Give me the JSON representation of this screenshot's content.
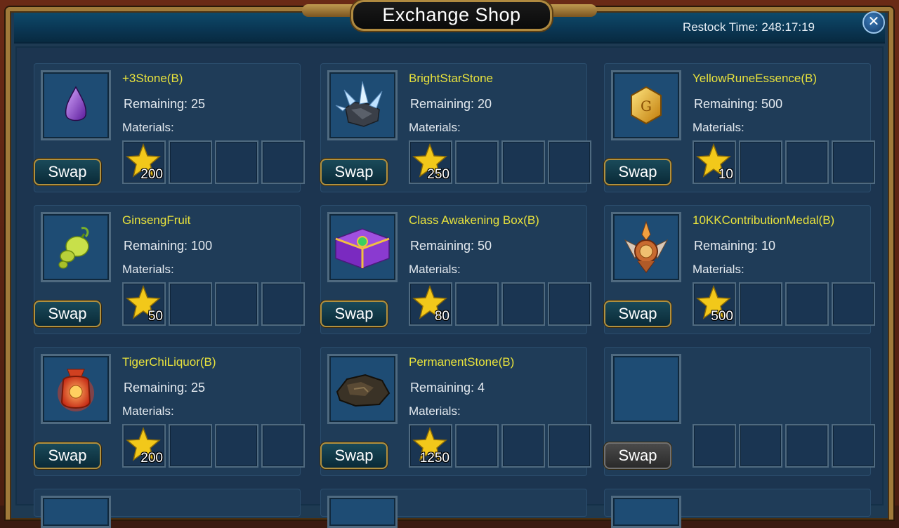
{
  "window": {
    "title": "Exchange Shop",
    "restock": "Restock Time: 248:17:19",
    "close_icon": "close-icon"
  },
  "items": [
    {
      "name": "+3Stone(B)",
      "remaining": "Remaining: 25",
      "materials_label": "Materials:",
      "material_qty": "200",
      "swap": "Swap",
      "icon": "purple-gem-icon"
    },
    {
      "name": "BrightStarStone",
      "remaining": "Remaining: 20",
      "materials_label": "Materials:",
      "material_qty": "250",
      "swap": "Swap",
      "icon": "crystal-ore-icon"
    },
    {
      "name": "YellowRuneEssence(B)",
      "remaining": "Remaining: 500",
      "materials_label": "Materials:",
      "material_qty": "10",
      "swap": "Swap",
      "icon": "yellow-rune-icon"
    },
    {
      "name": "GinsengFruit",
      "remaining": "Remaining: 100",
      "materials_label": "Materials:",
      "material_qty": "50",
      "swap": "Swap",
      "icon": "ginseng-fruit-icon"
    },
    {
      "name": "Class Awakening Box(B)",
      "remaining": "Remaining: 50",
      "materials_label": "Materials:",
      "material_qty": "80",
      "swap": "Swap",
      "icon": "treasure-box-icon"
    },
    {
      "name": "10KKContributionMedal(B)",
      "remaining": "Remaining: 10",
      "materials_label": "Materials:",
      "material_qty": "500",
      "swap": "Swap",
      "icon": "medal-icon"
    },
    {
      "name": "TigerChiLiquor(B)",
      "remaining": "Remaining: 25",
      "materials_label": "Materials:",
      "material_qty": "200",
      "swap": "Swap",
      "icon": "liquor-jar-icon"
    },
    {
      "name": "PermanentStone(B)",
      "remaining": "Remaining: 4",
      "materials_label": "Materials:",
      "material_qty": "1250",
      "swap": "Swap",
      "icon": "dark-stone-icon"
    },
    {
      "name": "",
      "remaining": "",
      "materials_label": "",
      "material_qty": "",
      "swap": "Swap",
      "icon": "empty-slot"
    }
  ],
  "colors": {
    "item_name": "#e8e23c",
    "panel": "#1f3c58",
    "header": "#0a3552",
    "gold_border": "#b09040"
  }
}
